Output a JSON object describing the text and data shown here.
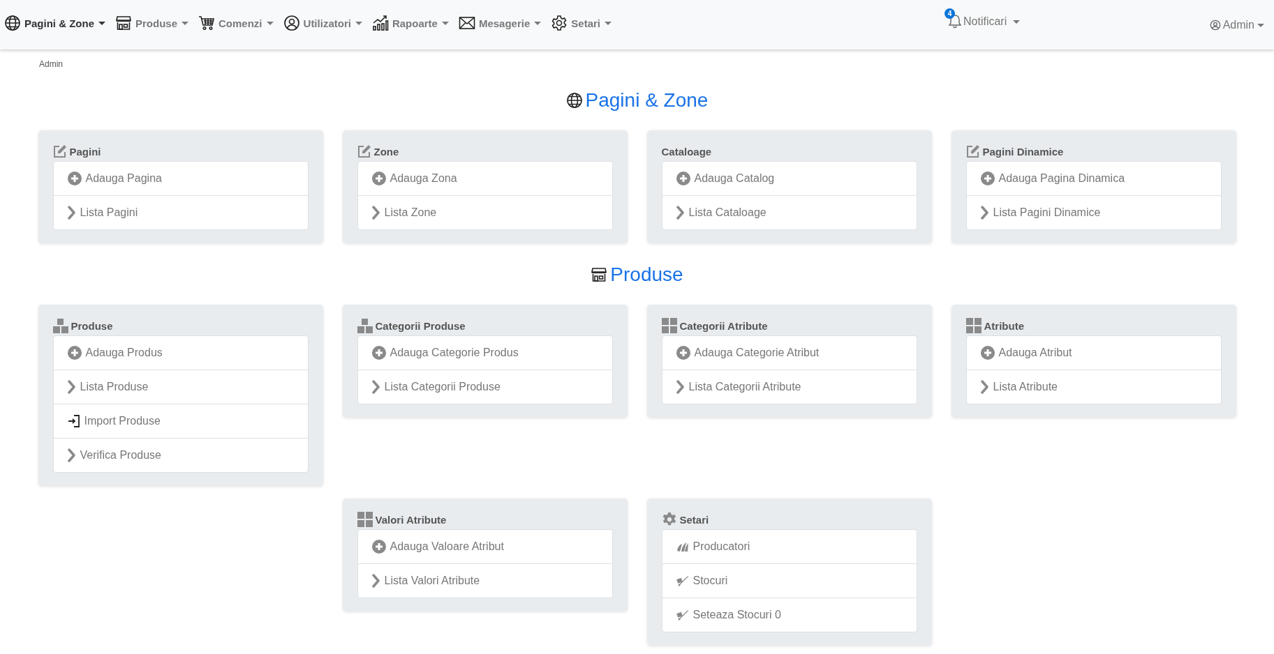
{
  "navbar": {
    "menus": [
      {
        "label": "Pagini & Zone",
        "kind": "globe",
        "selected": true
      },
      {
        "label": "Produse",
        "kind": "store",
        "selected": false
      },
      {
        "label": "Comenzi",
        "kind": "cart",
        "selected": false
      },
      {
        "label": "Utilizatori",
        "kind": "user",
        "selected": false
      },
      {
        "label": "Rapoarte",
        "kind": "chart",
        "selected": false
      },
      {
        "label": "Mesagerie",
        "kind": "mail",
        "selected": false
      },
      {
        "label": "Setari",
        "kind": "gear",
        "selected": false
      }
    ],
    "notifications": {
      "badge": "4",
      "label": "Notificari"
    },
    "account": {
      "label": "Admin"
    }
  },
  "breadcrumb": "Admin",
  "sections": [
    {
      "title": "Pagini & Zone",
      "kind": "globe",
      "cards": [
        {
          "title": "Pagini",
          "kind": "edit",
          "items": [
            {
              "label": "Adauga Pagina",
              "kind": "plus"
            },
            {
              "label": "Lista Pagini",
              "kind": "chevron"
            }
          ]
        },
        {
          "title": "Zone",
          "kind": "edit",
          "items": [
            {
              "label": "Adauga Zona",
              "kind": "plus"
            },
            {
              "label": "Lista Zone",
              "kind": "chevron"
            }
          ]
        },
        {
          "title": "Cataloage",
          "kind": "plain",
          "items": [
            {
              "label": "Adauga Catalog",
              "kind": "plus"
            },
            {
              "label": "Lista Cataloage",
              "kind": "chevron"
            }
          ]
        },
        {
          "title": "Pagini Dinamice",
          "kind": "edit",
          "items": [
            {
              "label": "Adauga Pagina Dinamica",
              "kind": "plus"
            },
            {
              "label": "Lista Pagini Dinamice",
              "kind": "chevron"
            }
          ]
        }
      ]
    },
    {
      "title": "Produse",
      "kind": "store",
      "cards": [
        {
          "title": "Produse",
          "kind": "boxes",
          "items": [
            {
              "label": "Adauga Produs",
              "kind": "plus"
            },
            {
              "label": "Lista Produse",
              "kind": "chevron"
            },
            {
              "label": "Import Produse",
              "kind": "import"
            },
            {
              "label": "Verifica Produse",
              "kind": "chevron"
            }
          ]
        },
        {
          "title": "Categorii Produse",
          "kind": "boxes",
          "items": [
            {
              "label": "Adauga Categorie Produs",
              "kind": "plus"
            },
            {
              "label": "Lista Categorii Produse",
              "kind": "chevron"
            }
          ]
        },
        {
          "title": "Categorii Atribute",
          "kind": "grid",
          "items": [
            {
              "label": "Adauga Categorie Atribut",
              "kind": "plus"
            },
            {
              "label": "Lista Categorii Atribute",
              "kind": "chevron"
            }
          ]
        },
        {
          "title": "Atribute",
          "kind": "grid",
          "items": [
            {
              "label": "Adauga Atribut",
              "kind": "plus"
            },
            {
              "label": "Lista Atribute",
              "kind": "chevron"
            }
          ]
        },
        {
          "title": "Valori Atribute",
          "kind": "grid",
          "items": [
            {
              "label": "Adauga Valoare Atribut",
              "kind": "plus"
            },
            {
              "label": "Lista Valori Atribute",
              "kind": "chevron"
            }
          ]
        },
        {
          "title": "Setari",
          "kind": "cog",
          "items": [
            {
              "label": "Producatori",
              "kind": "badges"
            },
            {
              "label": "Stocuri",
              "kind": "dolly"
            },
            {
              "label": "Seteaza Stocuri 0",
              "kind": "dolly"
            }
          ]
        }
      ]
    }
  ]
}
